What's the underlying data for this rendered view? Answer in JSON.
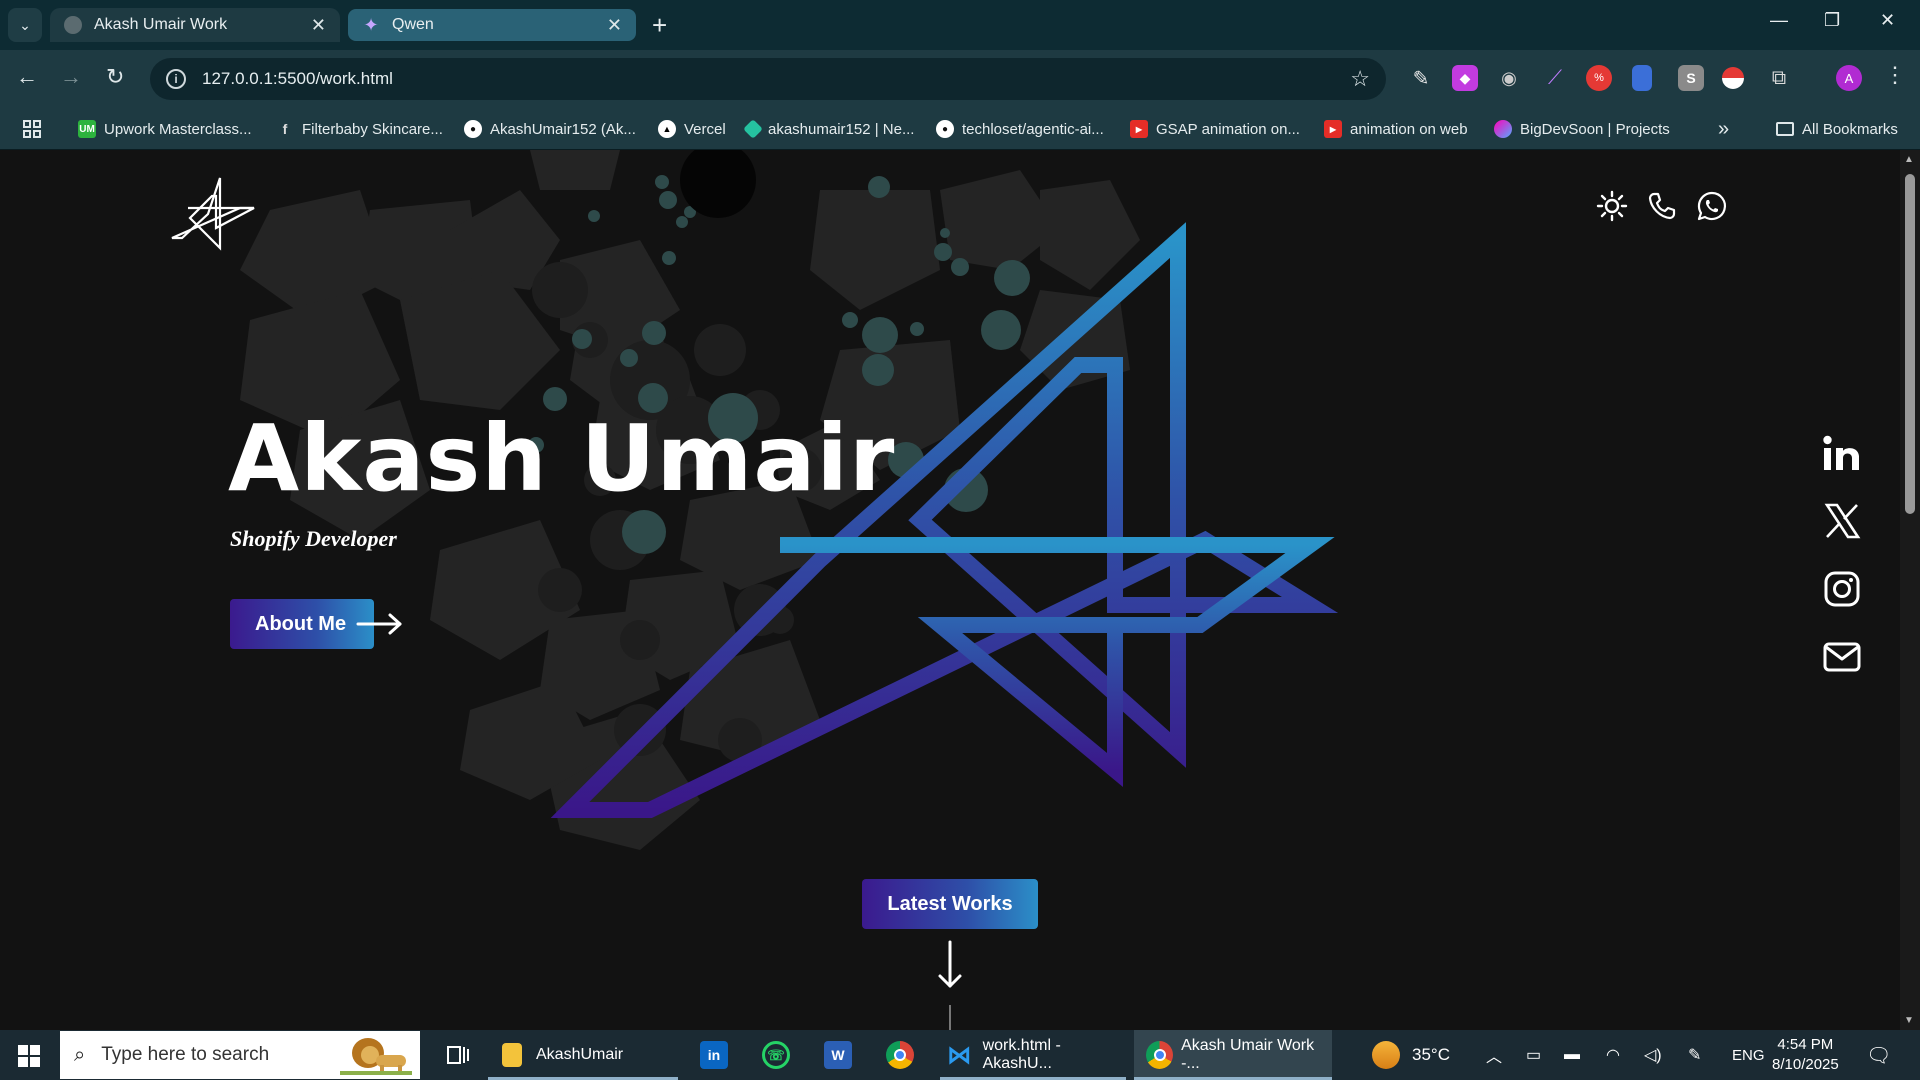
{
  "browser": {
    "tabs": [
      {
        "title": "Akash Umair Work",
        "active": true
      },
      {
        "title": "Qwen",
        "active": false
      }
    ],
    "url": "127.0.0.1:5500/work.html",
    "profile_initial": "A",
    "bookmarks": [
      {
        "label": "Upwork Masterclass...",
        "icon": "UM"
      },
      {
        "label": "Filterbaby Skincare...",
        "icon": "F"
      },
      {
        "label": "AkashUmair152 (Ak...",
        "icon": "github-icon"
      },
      {
        "label": "Vercel",
        "icon": "vercel-icon"
      },
      {
        "label": "akashumair152 | Ne...",
        "icon": "netlify-icon"
      },
      {
        "label": "techloset/agentic-ai...",
        "icon": "github-icon"
      },
      {
        "label": "GSAP animation on...",
        "icon": "youtube-icon"
      },
      {
        "label": "animation on web",
        "icon": "youtube-icon"
      },
      {
        "label": "BigDevSoon | Projects",
        "icon": "bigdevsoon-icon"
      }
    ],
    "all_bookmarks": "All Bookmarks"
  },
  "page": {
    "hero_name": "Akash Umair",
    "hero_role": "Shopify Developer",
    "about_button": "About Me",
    "latest_works_button": "Latest Works",
    "accent_gradient": [
      "#3b1a8e",
      "#2b8fc8"
    ]
  },
  "taskbar": {
    "search_placeholder": "Type here to search",
    "apps": [
      {
        "label": "AkashUmair",
        "icon": "folder-icon"
      },
      {
        "label": "",
        "icon": "linkedin-icon"
      },
      {
        "label": "",
        "icon": "whatsapp-icon"
      },
      {
        "label": "",
        "icon": "word-icon"
      },
      {
        "label": "",
        "icon": "chrome-icon"
      },
      {
        "label": "work.html - AkashU...",
        "icon": "vscode-icon"
      },
      {
        "label": "Akash Umair Work -...",
        "icon": "chrome-icon"
      }
    ],
    "weather": "35°C",
    "language": "ENG",
    "time": "4:54 PM",
    "date": "8/10/2025"
  }
}
